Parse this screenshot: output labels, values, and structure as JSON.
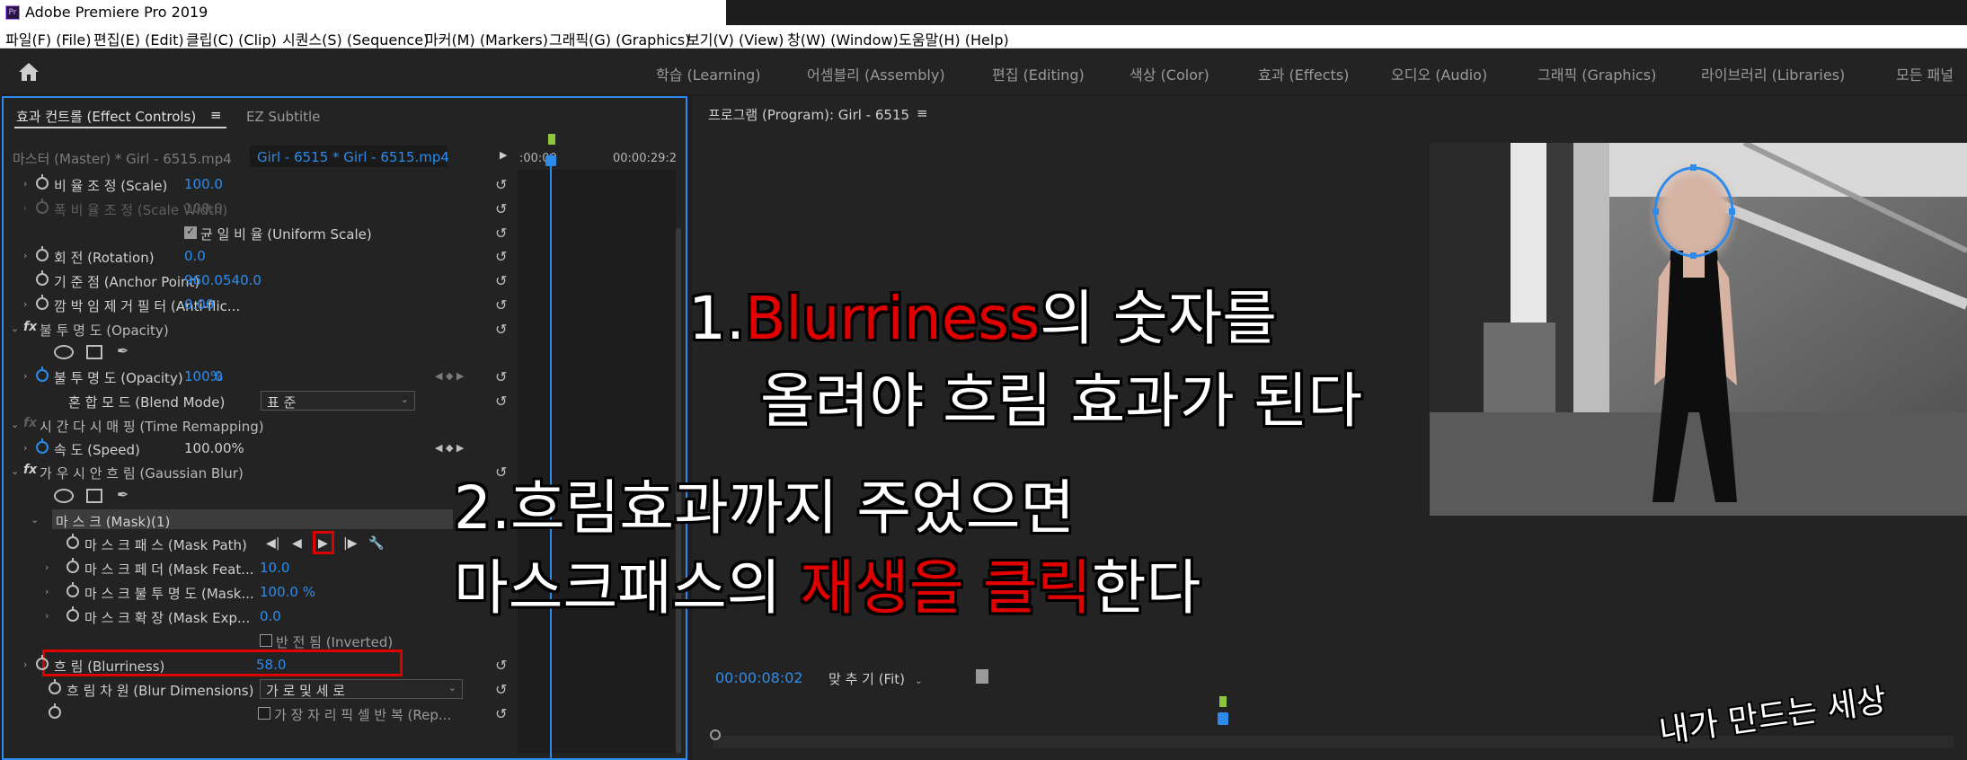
{
  "window": {
    "title": "Adobe Premiere Pro 2019",
    "app_icon": "Pr"
  },
  "menu": [
    "파일(F) (File)",
    "편집(E) (Edit)",
    "클립(C) (Clip)",
    "시퀀스(S) (Sequence)",
    "마커(M) (Markers)",
    "그래픽(G) (Graphics)",
    "보기(V) (View)",
    "창(W) (Window)",
    "도움말(H) (Help)"
  ],
  "workspaces": [
    "학습 (Learning)",
    "어셈블리 (Assembly)",
    "편집 (Editing)",
    "색상 (Color)",
    "효과 (Effects)",
    "오디오 (Audio)",
    "그래픽 (Graphics)",
    "라이브러리 (Libraries)",
    "모든 패널"
  ],
  "effect_controls": {
    "tab_active": "효과 컨트롤 (Effect Controls)",
    "tab_menu": "≡",
    "tab_inactive": "EZ Subtitle",
    "master_clip": "마스터 (Master) * Girl - 6515.mp4",
    "sequence_clip": "Girl - 6515 * Girl - 6515.mp4",
    "tc_start": ":00:00",
    "tc_end": "00:00:29:2",
    "rows": {
      "scale": {
        "label": "비 율 조 정 (Scale)",
        "value": "100.0"
      },
      "scale_width": {
        "label": "폭 비 율 조 정 (Scale Width)",
        "value": "100.0"
      },
      "uniform_scale": {
        "label": "균 일 비 율 (Uniform Scale)"
      },
      "rotation": {
        "label": "회 전 (Rotation)",
        "value": "0.0"
      },
      "anchor": {
        "label": "기 준 점 (Anchor Point)",
        "x": "960.0",
        "y": "540.0"
      },
      "antiflicker": {
        "label": "깜 박 임 제 거 필 터 (Anti-flic...",
        "value": "0.00"
      },
      "opacity_fx": {
        "label": "불 투 명 도 (Opacity)"
      },
      "opacity": {
        "label": "불 투 명 도 (Opacity)",
        "value": "100.0",
        "unit": "%"
      },
      "blend_mode": {
        "label": "혼 합 모 드 (Blend Mode)",
        "value": "표 준"
      },
      "time_remap": {
        "label": "시 간 다 시 매 핑 (Time Remapping)"
      },
      "speed": {
        "label": "속 도 (Speed)",
        "value": "100.00%"
      },
      "gaussian": {
        "label": "가 우 시 안 흐 림 (Gaussian Blur)"
      },
      "mask": {
        "label": "마 스 크 (Mask)(1)"
      },
      "mask_path": {
        "label": "마 스 크 패 스 (Mask Path)"
      },
      "mask_feather": {
        "label": "마 스 크 페 더 (Mask Feat...",
        "value": "10.0"
      },
      "mask_opacity": {
        "label": "마 스 크 불 투 명 도 (Mask...",
        "value": "100.0 %"
      },
      "mask_expansion": {
        "label": "마 스 크 확 장 (Mask Exp...",
        "value": "0.0"
      },
      "inverted": {
        "label": "반 전 됨 (Inverted)"
      },
      "blurriness": {
        "label": "흐 림 (Blurriness)",
        "value": "58.0"
      },
      "blur_dim": {
        "label": "흐 림 차 원 (Blur Dimensions)",
        "value": "가 로 및 세 로"
      },
      "repeat_edge": {
        "label": "가 장 자 리 픽 셀 반 복 (Rep..."
      }
    }
  },
  "program": {
    "title": "프로그램 (Program): Girl - 6515",
    "menu": "≡",
    "timecode": "00:00:08:02",
    "zoom": "맞 추 기 (Fit)"
  },
  "annotations": {
    "line1_num": "1.",
    "line1_red": "Blurriness",
    "line1_rest": "의 숫자를",
    "line2": "올려야 흐림 효과가 된다",
    "line3": "2.흐림효과까지 주었으면",
    "line4_a": "마스크패스의 ",
    "line4_red": "재생을 클릭",
    "line4_b": "한다",
    "signature": "내가 만드는 세상"
  },
  "colors": {
    "accent": "#2d8ceb",
    "highlight": "#e10000",
    "keyframe_in": "#8cc63f"
  }
}
